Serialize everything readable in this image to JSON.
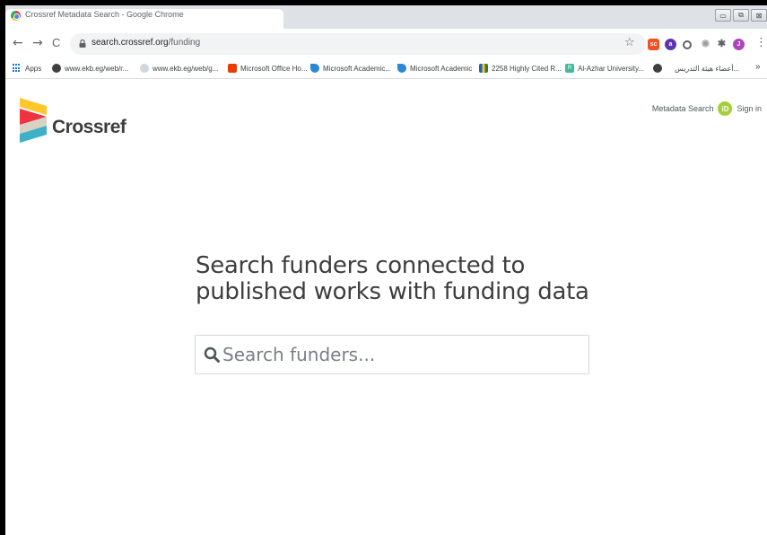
{
  "browser": {
    "tab_title": "Crossref Metadata Search - Google Chrome",
    "window_buttons": {
      "minimize": "▭",
      "restore": "⧉",
      "close": "⊠"
    },
    "nav": {
      "back": "←",
      "forward": "→",
      "reload": "C"
    },
    "url_host": "search.crossref.org",
    "url_path": "/funding",
    "star": "☆",
    "menu": "⋮"
  },
  "bookmarks": [
    {
      "label": "Apps",
      "icon": "apps-grid-icon"
    },
    {
      "label": "www.ekb.eg/web/r...",
      "icon": "globe-icon"
    },
    {
      "label": "www.ekb.eg/web/g...",
      "icon": "globe-icon"
    },
    {
      "label": "Microsoft Office Ho...",
      "icon": "office-icon"
    },
    {
      "label": "Microsoft Academic...",
      "icon": "academic-icon"
    },
    {
      "label": "Microsoft Academic",
      "icon": "academic-icon"
    },
    {
      "label": "2258 Highly Cited R...",
      "icon": "bar-chart-icon"
    },
    {
      "label": "Al-Azhar University...",
      "icon": "rg-icon"
    },
    {
      "label": "أعضاء هيئة التدريس...",
      "icon": "globe-icon"
    },
    {
      "label": "»",
      "icon": ""
    }
  ],
  "page": {
    "logo_text": "Crossref",
    "nav_metadata": "Metadata Search",
    "orcid": "iD",
    "nav_signin": "Sign in",
    "headline_line1": "Search funders connected to",
    "headline_line2": "published works with funding data",
    "search_placeholder": "Search funders...",
    "search_value": ""
  },
  "colors": {
    "logo_yellow": "#ffc72c",
    "logo_red": "#ef3340",
    "logo_grey": "#d8d2c4",
    "logo_teal": "#3eb1c8",
    "orcid_green": "#a6ce39"
  }
}
